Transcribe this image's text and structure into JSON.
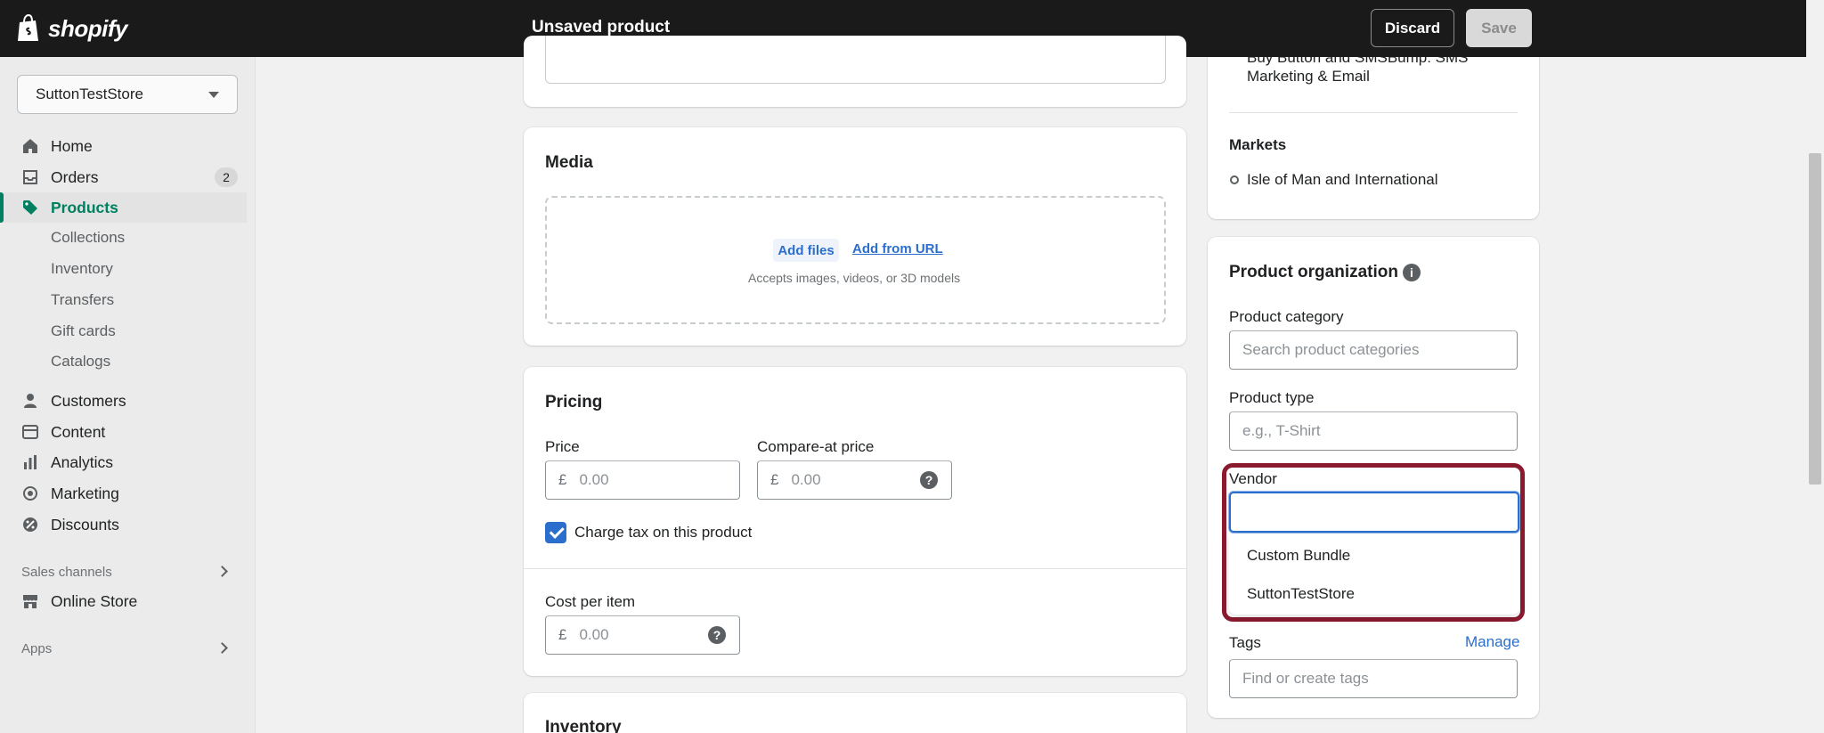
{
  "header": {
    "brand": "shopify",
    "title": "Unsaved product",
    "discard_label": "Discard",
    "save_label": "Save"
  },
  "sidebar": {
    "store_name": "SuttonTestStore",
    "nav": [
      {
        "label": "Home",
        "icon": "home-icon"
      },
      {
        "label": "Orders",
        "icon": "orders-icon",
        "badge": "2"
      },
      {
        "label": "Products",
        "icon": "tag-icon",
        "active": true
      },
      {
        "label": "Collections"
      },
      {
        "label": "Inventory"
      },
      {
        "label": "Transfers"
      },
      {
        "label": "Gift cards"
      },
      {
        "label": "Catalogs"
      },
      {
        "label": "Customers",
        "icon": "person-icon"
      },
      {
        "label": "Content",
        "icon": "content-icon"
      },
      {
        "label": "Analytics",
        "icon": "bar-chart-icon"
      },
      {
        "label": "Marketing",
        "icon": "target-icon"
      },
      {
        "label": "Discounts",
        "icon": "discount-icon"
      }
    ],
    "sales_channels_label": "Sales channels",
    "online_store_label": "Online Store",
    "apps_label": "Apps"
  },
  "media": {
    "title": "Media",
    "add_files": "Add files",
    "add_from_url": "Add from URL",
    "accepts": "Accepts images, videos, or 3D models"
  },
  "pricing": {
    "title": "Pricing",
    "price_label": "Price",
    "price_placeholder": "0.00",
    "compare_label": "Compare-at price",
    "compare_placeholder": "0.00",
    "currency": "£",
    "charge_tax_label": "Charge tax on this product",
    "charge_tax_checked": true,
    "cost_label": "Cost per item",
    "cost_placeholder": "0.00"
  },
  "inventory": {
    "title": "Inventory"
  },
  "sales_card": {
    "channel_text_line1": "Buy Button and SMSBump: SMS",
    "channel_text_line2": "Marketing & Email",
    "markets_title": "Markets",
    "market_item": "Isle of Man and International"
  },
  "organization": {
    "title": "Product organization",
    "category_label": "Product category",
    "category_placeholder": "Search product categories",
    "type_label": "Product type",
    "type_placeholder": "e.g., T-Shirt",
    "vendor_label": "Vendor",
    "vendor_value": "",
    "vendor_options": [
      "Custom Bundle",
      "SuttonTestStore"
    ],
    "tags_label": "Tags",
    "manage_label": "Manage",
    "tags_placeholder": "Find or create tags"
  },
  "colors": {
    "accent_green": "#008060",
    "link_blue": "#2c6ecb",
    "highlight_border": "#8b1a2f"
  }
}
